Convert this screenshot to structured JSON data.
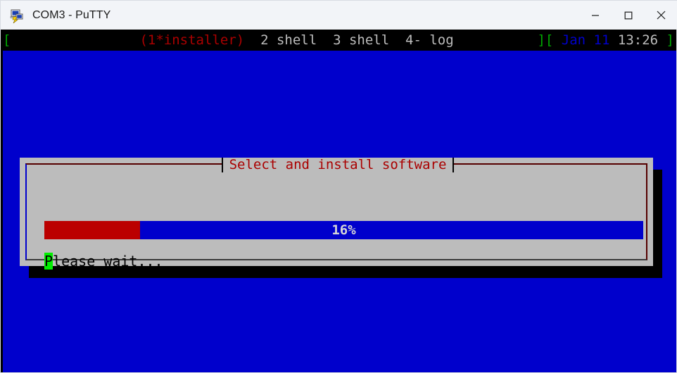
{
  "window": {
    "title": "COM3 - PuTTY",
    "icon": "putty-icon",
    "buttons": {
      "minimize": "minimize-icon",
      "maximize": "maximize-icon",
      "close": "close-icon"
    }
  },
  "terminal": {
    "background_color": "#0000cc",
    "status_bar": {
      "background_color": "#000000",
      "open_bracket": "[",
      "windows": [
        {
          "label": "(1*installer)",
          "open_paren": "(",
          "name": "1*installer",
          "close_paren": ")",
          "active": true
        },
        {
          "label": "2 shell",
          "active": false
        },
        {
          "label": "3 shell",
          "active": false
        },
        {
          "label": "4- log",
          "active": false
        }
      ],
      "close_bracket": "]",
      "right_open_bracket": "[",
      "date": "Jan 11",
      "time": "13:26",
      "right_close_bracket": "]",
      "colors": {
        "bracket": "#00aa00",
        "active_window": "#aa0000",
        "inactive_window": "#bdbdbd",
        "date": "#0000cc",
        "time": "#bdbdbd"
      }
    }
  },
  "dialog": {
    "title": "Select and install software",
    "title_color": "#aa0000",
    "background_color": "#bcbcbc",
    "progress": {
      "percent": 16,
      "label": "16%",
      "fill_color": "#bb0000",
      "trough_color": "#0000cc",
      "label_color": "#d6d6d6"
    },
    "message": {
      "cursor_char": "P",
      "rest": "lease wait...",
      "full_text": "Please wait...",
      "cursor_color": "#00ee00"
    }
  }
}
